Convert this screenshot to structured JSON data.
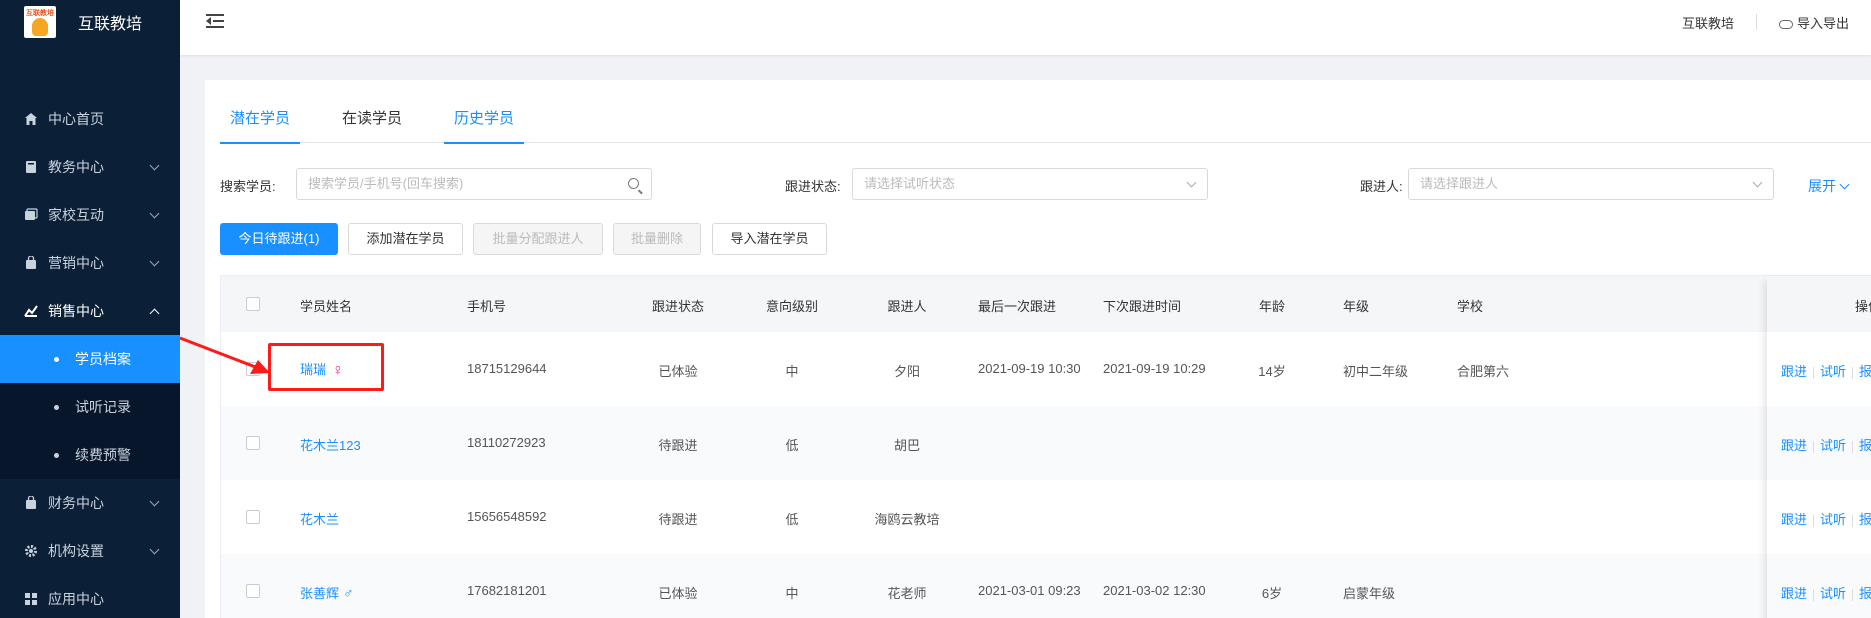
{
  "brand": {
    "name": "互联教培",
    "logo_text": "互联教培"
  },
  "sidebar": {
    "items": [
      {
        "label": "中心首页",
        "icon": "home-icon",
        "has_arrow": false
      },
      {
        "label": "教务中心",
        "icon": "book-icon",
        "has_arrow": true
      },
      {
        "label": "家校互动",
        "icon": "interact-icon",
        "has_arrow": true
      },
      {
        "label": "营销中心",
        "icon": "marketing-icon",
        "has_arrow": true
      },
      {
        "label": "销售中心",
        "icon": "sales-icon",
        "has_arrow": true,
        "open": true
      },
      {
        "label": "财务中心",
        "icon": "finance-icon",
        "has_arrow": true
      },
      {
        "label": "机构设置",
        "icon": "settings-icon",
        "has_arrow": true
      },
      {
        "label": "应用中心",
        "icon": "apps-icon",
        "has_arrow": false
      }
    ],
    "sub_items": [
      {
        "label": "学员档案",
        "active": true
      },
      {
        "label": "试听记录",
        "active": false
      },
      {
        "label": "续费预警",
        "active": false
      }
    ]
  },
  "topbar": {
    "org_name": "互联教培",
    "import_export": "导入导出"
  },
  "tabs": [
    {
      "label": "潜在学员",
      "active": true,
      "underline": true
    },
    {
      "label": "在读学员",
      "active": false,
      "underline": false
    },
    {
      "label": "历史学员",
      "active": true,
      "underline": true
    }
  ],
  "filters": {
    "search_label": "搜索学员:",
    "search_placeholder": "搜索学员/手机号(回车搜索)",
    "status_label": "跟进状态:",
    "status_placeholder": "请选择试听状态",
    "follower_label": "跟进人:",
    "follower_placeholder": "请选择跟进人",
    "expand_label": "展开"
  },
  "buttons": {
    "today": "今日待跟进(1)",
    "add": "添加潜在学员",
    "batch_assign": "批量分配跟进人",
    "batch_delete": "批量删除",
    "import": "导入潜在学员"
  },
  "table": {
    "headers": {
      "name": "学员姓名",
      "phone": "手机号",
      "status": "跟进状态",
      "intent": "意向级别",
      "follower": "跟进人",
      "last": "最后一次跟进",
      "next": "下次跟进时间",
      "age": "年龄",
      "grade": "年级",
      "school": "学校",
      "ops": "操作"
    },
    "rows": [
      {
        "name": "瑞瑞",
        "gender": "♀",
        "phone": "18715129644",
        "status": "已体验",
        "intent": "中",
        "follower": "夕阳",
        "last": "2021-09-19 10:30",
        "next": "2021-09-19 10:29",
        "age": "14岁",
        "grade": "初中二年级",
        "school": "合肥第六"
      },
      {
        "name": "花木兰123",
        "gender": "",
        "phone": "18110272923",
        "status": "待跟进",
        "intent": "低",
        "follower": "胡巴",
        "last": "",
        "next": "",
        "age": "",
        "grade": "",
        "school": ""
      },
      {
        "name": "花木兰",
        "gender": "",
        "phone": "15656548592",
        "status": "待跟进",
        "intent": "低",
        "follower": "海鸥云教培",
        "last": "",
        "next": "",
        "age": "",
        "grade": "",
        "school": ""
      },
      {
        "name": "张善辉",
        "gender": "♂",
        "phone": "17682181201",
        "status": "已体验",
        "intent": "中",
        "follower": "花老师",
        "last": "2021-03-01 09:23",
        "next": "2021-03-02 12:30",
        "age": "6岁",
        "grade": "启蒙年级",
        "school": ""
      }
    ],
    "op_labels": {
      "follow": "跟进",
      "trial": "试听",
      "signup": "报名"
    }
  },
  "colors": {
    "primary": "#1890ff",
    "sidebar_bg": "#0b1f36",
    "annotation": "#ff1a1a"
  }
}
